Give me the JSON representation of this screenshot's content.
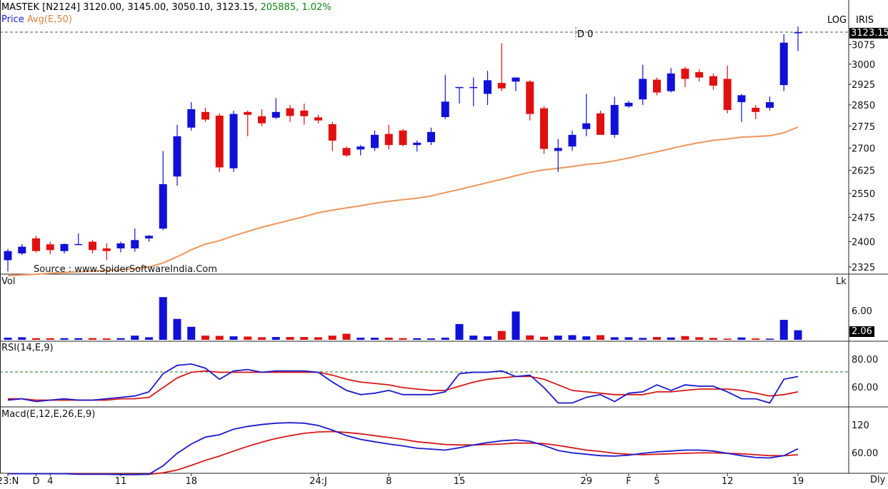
{
  "header": {
    "symbol": "MASTEK [N2124]",
    "open": "3120.00",
    "high": "3145.00",
    "low": "3050.10",
    "close": "3123.15",
    "volume": "205885",
    "change": "1.02%",
    "price_label": "Price",
    "avg_label": "Avg(E,50)",
    "log_label": "LOG",
    "iris_label": "IRIS",
    "d0_label": "D 0",
    "source": "Source : www.SpiderSoftwareIndia.Com",
    "last_price": "3123.15",
    "timeframe": "Dly"
  },
  "colors": {
    "up": "#1010d8",
    "down": "#e01010",
    "ema": "#f0955a",
    "rsi": "#1a1ad0",
    "rsi_signal": "#d81818",
    "macd": "#1a1ad0",
    "macd_signal": "#d81818",
    "ref_line": "#2a6a2a"
  },
  "panels": {
    "volume": {
      "label": "Vol",
      "unit": "Lk",
      "tick": "6.00",
      "last": "2.06"
    },
    "rsi": {
      "label": "RSI(14,E,9)",
      "ticks": [
        "80.00",
        "60.00"
      ]
    },
    "macd": {
      "label": "Macd(E,12,E,26,E,9)",
      "ticks": [
        "120",
        "60.00"
      ]
    }
  },
  "chart_data": {
    "type": "candlestick",
    "scale": "log",
    "ylim": [
      2300,
      3150
    ],
    "yticks": [
      "3075",
      "3000",
      "2925",
      "2850",
      "2775",
      "2700",
      "2625",
      "2550",
      "2475",
      "2400",
      "2325"
    ],
    "xticks": [
      {
        "i": 0,
        "label": "23:N"
      },
      {
        "i": 2,
        "label": "D"
      },
      {
        "i": 3,
        "label": "4"
      },
      {
        "i": 8,
        "label": "11"
      },
      {
        "i": 13,
        "label": "18"
      },
      {
        "i": 22,
        "label": "24:J"
      },
      {
        "i": 27,
        "label": "8"
      },
      {
        "i": 32,
        "label": "15"
      },
      {
        "i": 41,
        "label": "29"
      },
      {
        "i": 44,
        "label": "F"
      },
      {
        "i": 46,
        "label": "5"
      },
      {
        "i": 51,
        "label": "12"
      },
      {
        "i": 56,
        "label": "19"
      }
    ],
    "candles": [
      [
        2345,
        2378,
        2312,
        2372
      ],
      [
        2365,
        2393,
        2360,
        2385
      ],
      [
        2410,
        2418,
        2368,
        2372
      ],
      [
        2392,
        2400,
        2362,
        2375
      ],
      [
        2372,
        2395,
        2365,
        2393
      ],
      [
        2392,
        2425,
        2390,
        2393
      ],
      [
        2400,
        2405,
        2365,
        2375
      ],
      [
        2380,
        2395,
        2345,
        2372
      ],
      [
        2380,
        2400,
        2368,
        2395
      ],
      [
        2380,
        2440,
        2370,
        2405
      ],
      [
        2410,
        2420,
        2400,
        2418
      ],
      [
        2440,
        2690,
        2435,
        2580
      ],
      [
        2605,
        2780,
        2575,
        2740
      ],
      [
        2770,
        2860,
        2760,
        2835
      ],
      [
        2825,
        2840,
        2790,
        2798
      ],
      [
        2812,
        2820,
        2620,
        2635
      ],
      [
        2632,
        2830,
        2620,
        2818
      ],
      [
        2825,
        2830,
        2740,
        2815
      ],
      [
        2810,
        2835,
        2775,
        2785
      ],
      [
        2805,
        2875,
        2800,
        2825
      ],
      [
        2838,
        2850,
        2790,
        2811
      ],
      [
        2830,
        2855,
        2780,
        2810
      ],
      [
        2806,
        2815,
        2785,
        2795
      ],
      [
        2782,
        2790,
        2690,
        2725
      ],
      [
        2700,
        2705,
        2670,
        2675
      ],
      [
        2695,
        2710,
        2675,
        2705
      ],
      [
        2700,
        2760,
        2690,
        2745
      ],
      [
        2748,
        2780,
        2695,
        2710
      ],
      [
        2760,
        2765,
        2705,
        2710
      ],
      [
        2710,
        2725,
        2688,
        2718
      ],
      [
        2720,
        2770,
        2710,
        2755
      ],
      [
        2807,
        2960,
        2800,
        2862
      ],
      [
        2915,
        2915,
        2855,
        2915
      ],
      [
        2915,
        2950,
        2845,
        2915
      ],
      [
        2890,
        2975,
        2850,
        2940
      ],
      [
        2930,
        3080,
        2900,
        2910
      ],
      [
        2935,
        2945,
        2900,
        2950
      ],
      [
        2935,
        2940,
        2795,
        2818
      ],
      [
        2838,
        2845,
        2680,
        2697
      ],
      [
        2690,
        2730,
        2620,
        2700
      ],
      [
        2705,
        2760,
        2690,
        2745
      ],
      [
        2765,
        2890,
        2740,
        2785
      ],
      [
        2820,
        2830,
        2750,
        2745
      ],
      [
        2745,
        2880,
        2735,
        2850
      ],
      [
        2845,
        2865,
        2840,
        2858
      ],
      [
        2870,
        2998,
        2850,
        2945
      ],
      [
        2942,
        2950,
        2885,
        2895
      ],
      [
        2900,
        2985,
        2895,
        2965
      ],
      [
        2983,
        2990,
        2915,
        2945
      ],
      [
        2970,
        2980,
        2935,
        2950
      ],
      [
        2955,
        2965,
        2905,
        2920
      ],
      [
        2945,
        2995,
        2820,
        2832
      ],
      [
        2860,
        2890,
        2790,
        2885
      ],
      [
        2840,
        2850,
        2800,
        2825
      ],
      [
        2840,
        2880,
        2830,
        2860
      ],
      [
        2922,
        3115,
        2900,
        3082
      ],
      [
        3120,
        3145,
        3050,
        3123
      ]
    ],
    "ema50": [
      2300,
      2302,
      2304,
      2307,
      2309,
      2311,
      2313,
      2315,
      2317,
      2320,
      2325,
      2337,
      2355,
      2376,
      2393,
      2403,
      2418,
      2431,
      2444,
      2455,
      2466,
      2477,
      2489,
      2497,
      2504,
      2511,
      2519,
      2525,
      2530,
      2535,
      2542,
      2553,
      2563,
      2574,
      2585,
      2596,
      2608,
      2619,
      2627,
      2632,
      2638,
      2645,
      2649,
      2657,
      2666,
      2677,
      2687,
      2698,
      2709,
      2718,
      2726,
      2731,
      2737,
      2739,
      2742,
      2752,
      2772
    ],
    "volume": [
      0.45,
      0.55,
      0.35,
      0.35,
      0.35,
      0.35,
      0.35,
      0.3,
      0.35,
      0.9,
      0.55,
      9.2,
      4.5,
      2.8,
      0.9,
      0.85,
      0.75,
      0.7,
      0.55,
      0.6,
      0.6,
      0.6,
      0.55,
      0.9,
      1.3,
      0.45,
      0.45,
      0.45,
      0.35,
      0.35,
      0.3,
      0.45,
      3.4,
      0.9,
      0.75,
      1.9,
      6.1,
      0.95,
      0.65,
      0.9,
      1.0,
      0.75,
      1.0,
      0.55,
      0.55,
      0.4,
      0.6,
      0.5,
      0.8,
      0.55,
      0.4,
      0.25,
      0.5,
      0.3,
      0.25,
      4.3,
      2.06
    ],
    "rsi": [
      51,
      52,
      50,
      51,
      52,
      51,
      51,
      52,
      53,
      54,
      57,
      70,
      76,
      77,
      74,
      66,
      72,
      73,
      71,
      72,
      72,
      72,
      71,
      64,
      58,
      55,
      56,
      58,
      55,
      55,
      55,
      57,
      70,
      71,
      71,
      72,
      68,
      69,
      60,
      49,
      49,
      53,
      55,
      50,
      56,
      57,
      62,
      58,
      62,
      61,
      61,
      57,
      52,
      52,
      49,
      66,
      68
    ],
    "rsi_signal": [
      52,
      52,
      51,
      51,
      51,
      51,
      51,
      51,
      52,
      52,
      53,
      60,
      67,
      71,
      72,
      71,
      71,
      71,
      71,
      71,
      71,
      71,
      71,
      69,
      66,
      64,
      63,
      62,
      60,
      59,
      58,
      58,
      61,
      64,
      66,
      67,
      68,
      68,
      66,
      62,
      58,
      57,
      56,
      55,
      55,
      55,
      57,
      57,
      58,
      59,
      59,
      59,
      58,
      56,
      54,
      55,
      57
    ],
    "macd": [
      16,
      16,
      16,
      16,
      16,
      15,
      15,
      15,
      14,
      14,
      15,
      33,
      60,
      80,
      95,
      100,
      112,
      118,
      122,
      125,
      126,
      125,
      120,
      110,
      98,
      90,
      85,
      80,
      76,
      71,
      69,
      67,
      72,
      78,
      83,
      87,
      89,
      86,
      77,
      66,
      61,
      58,
      55,
      54,
      56,
      60,
      63,
      65,
      67,
      67,
      65,
      60,
      55,
      51,
      50,
      55,
      70
    ],
    "macd_signal": [
      16,
      16,
      16,
      16,
      16,
      16,
      16,
      16,
      15,
      15,
      15,
      18,
      24,
      34,
      45,
      54,
      65,
      75,
      84,
      92,
      98,
      103,
      106,
      107,
      105,
      102,
      98,
      94,
      90,
      85,
      82,
      79,
      78,
      78,
      79,
      80,
      82,
      82,
      81,
      77,
      72,
      67,
      64,
      60,
      58,
      57,
      58,
      59,
      60,
      61,
      61,
      60,
      59,
      57,
      55,
      55,
      57
    ]
  }
}
